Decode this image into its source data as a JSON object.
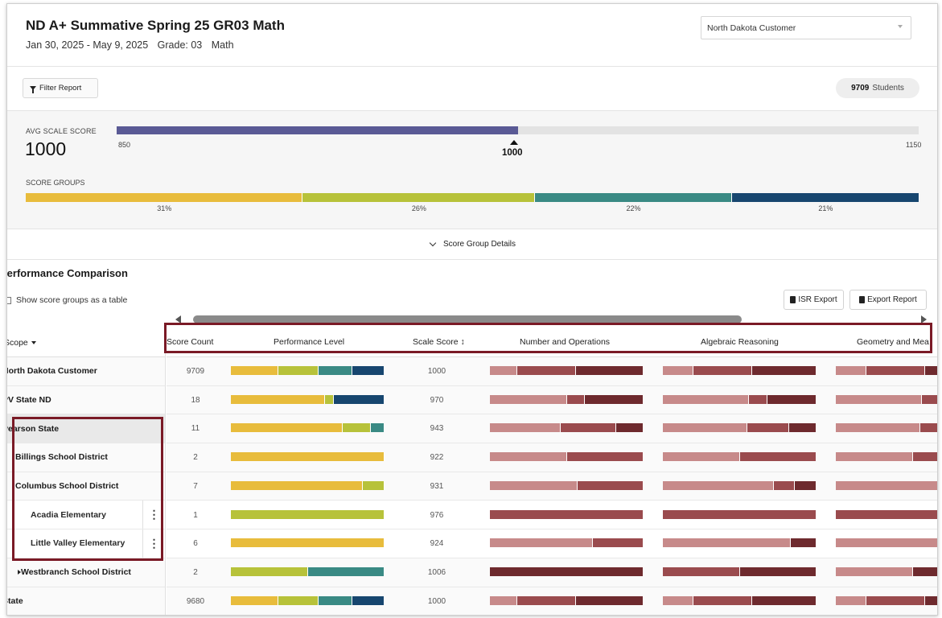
{
  "header": {
    "title": "ND A+ Summative Spring 25 GR03 Math",
    "date_range": "Jan 30, 2025 - May 9, 2025",
    "grade": "Grade: 03",
    "subject": "Math",
    "org_select": "North Dakota Customer"
  },
  "filterbar": {
    "filter_label": "Filter Report",
    "student_count": "9709",
    "students_label": "Students"
  },
  "summary": {
    "avg_label": "AVG SCALE SCORE",
    "avg_value": "1000",
    "scale_min": "850",
    "scale_max": "1150",
    "marker_value": "1000",
    "avg_fraction": 0.5,
    "groups_label": "SCORE GROUPS",
    "groups": [
      {
        "pct_label": "31%",
        "fraction": 0.31,
        "color": "#e8bc3c"
      },
      {
        "pct_label": "26%",
        "fraction": 0.26,
        "color": "#b7c23a"
      },
      {
        "pct_label": "22%",
        "fraction": 0.22,
        "color": "#3a8a84"
      },
      {
        "pct_label": "21%",
        "fraction": 0.21,
        "color": "#17466f"
      }
    ],
    "details_label": "Score Group Details"
  },
  "comparison": {
    "title": "Performance Comparison",
    "toggle_label": "Show score groups as a table",
    "isr_export": "ISR Export",
    "export_report": "Export Report",
    "scope_header": "Scope",
    "columns": {
      "score_count": "Score Count",
      "performance_level": "Performance Level",
      "scale_score": "Scale Score ↕",
      "number_ops": "Number and Operations",
      "algebraic": "Algebraic Reasoning",
      "geometry": "Geometry and Mea"
    },
    "colors": {
      "light": "#c78a8a",
      "mid": "#9a4b4e",
      "dark": "#6e2a2e"
    },
    "rows": [
      {
        "scope": "North Dakota Customer",
        "count": "9709",
        "scale": "1000",
        "pl": [
          0.31,
          0.26,
          0.22,
          0.21
        ],
        "s1": [
          0.18,
          0.38,
          0.44
        ],
        "s2": [
          0.2,
          0.38,
          0.42
        ],
        "s3": [
          0.2,
          0.38,
          0.42
        ]
      },
      {
        "scope": "PV State ND",
        "count": "18",
        "scale": "970",
        "pl": [
          0.61,
          0.06,
          0.0,
          0.33
        ],
        "s1": [
          0.5,
          0.12,
          0.38
        ],
        "s2": [
          0.56,
          0.12,
          0.32
        ],
        "s3": [
          0.56,
          0.12,
          0.32
        ]
      },
      {
        "scope": "Pearson State",
        "count": "11",
        "scale": "943",
        "pl": [
          0.73,
          0.18,
          0.09,
          0.0
        ],
        "s1": [
          0.46,
          0.36,
          0.18
        ],
        "s2": [
          0.55,
          0.27,
          0.18
        ],
        "s3": [
          0.55,
          0.27,
          0.18
        ]
      },
      {
        "scope": "Billings School District",
        "count": "2",
        "scale": "922",
        "pl": [
          1.0,
          0.0,
          0.0,
          0.0
        ],
        "s1": [
          0.5,
          0.5,
          0.0
        ],
        "s2": [
          0.5,
          0.5,
          0.0
        ],
        "s3": [
          0.5,
          0.5,
          0.0
        ]
      },
      {
        "scope": "Columbus School District",
        "count": "7",
        "scale": "931",
        "pl": [
          0.86,
          0.14,
          0.0,
          0.0
        ],
        "s1": [
          0.57,
          0.43,
          0.0
        ],
        "s2": [
          0.72,
          0.14,
          0.14
        ],
        "s3": [
          0.72,
          0.14,
          0.14
        ]
      },
      {
        "scope": "Acadia Elementary",
        "count": "1",
        "scale": "976",
        "pl": [
          0.0,
          1.0,
          0.0,
          0.0
        ],
        "s1": [
          0.0,
          1.0,
          0.0
        ],
        "s2": [
          0.0,
          1.0,
          0.0
        ],
        "s3": [
          0.0,
          1.0,
          0.0
        ]
      },
      {
        "scope": "Little Valley Elementary",
        "count": "6",
        "scale": "924",
        "pl": [
          1.0,
          0.0,
          0.0,
          0.0
        ],
        "s1": [
          0.67,
          0.33,
          0.0
        ],
        "s2": [
          0.83,
          0.0,
          0.17
        ],
        "s3": [
          0.83,
          0.0,
          0.17
        ]
      },
      {
        "scope": "Westbranch School District",
        "count": "2",
        "scale": "1006",
        "pl": [
          0.0,
          0.5,
          0.5,
          0.0
        ],
        "s1": [
          0.0,
          0.0,
          1.0
        ],
        "s2": [
          0.0,
          0.5,
          0.5
        ],
        "s3": [
          0.5,
          0.0,
          0.5
        ]
      },
      {
        "scope": "State",
        "count": "9680",
        "scale": "1000",
        "pl": [
          0.31,
          0.26,
          0.22,
          0.21
        ],
        "s1": [
          0.18,
          0.38,
          0.44
        ],
        "s2": [
          0.2,
          0.38,
          0.42
        ],
        "s3": [
          0.2,
          0.38,
          0.42
        ]
      }
    ]
  }
}
